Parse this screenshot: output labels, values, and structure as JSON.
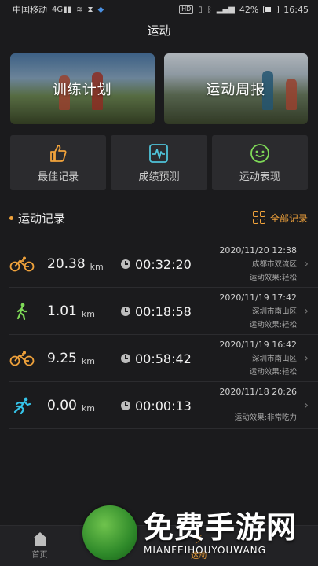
{
  "statusbar": {
    "carrier": "中国移动",
    "battery": "42%",
    "time": "16:45"
  },
  "header": {
    "title": "运动"
  },
  "banners": [
    {
      "label": "训练计划"
    },
    {
      "label": "运动周报"
    }
  ],
  "features": [
    {
      "label": "最佳记录",
      "icon": "thumbs-up-icon"
    },
    {
      "label": "成绩预测",
      "icon": "waveform-icon"
    },
    {
      "label": "运动表现",
      "icon": "smiley-icon"
    }
  ],
  "records_section": {
    "title": "运动记录",
    "all_link": "全部记录",
    "accent": "#f0a23b"
  },
  "records": [
    {
      "type": "cycling",
      "icon": "bicycle-icon",
      "distance": "20.38",
      "unit": "km",
      "duration": "00:32:20",
      "date": "2020/11/20 12:38",
      "location": "成都市双流区",
      "effect": "运动效果:轻松"
    },
    {
      "type": "walking",
      "icon": "walking-icon",
      "distance": "1.01",
      "unit": "km",
      "duration": "00:18:58",
      "date": "2020/11/19 17:42",
      "location": "深圳市南山区",
      "effect": "运动效果:轻松"
    },
    {
      "type": "cycling",
      "icon": "bicycle-icon",
      "distance": "9.25",
      "unit": "km",
      "duration": "00:58:42",
      "date": "2020/11/19 16:42",
      "location": "深圳市南山区",
      "effect": "运动效果:轻松"
    },
    {
      "type": "running",
      "icon": "running-icon",
      "distance": "0.00",
      "unit": "km",
      "duration": "00:00:13",
      "date": "2020/11/18 20:26",
      "location": "",
      "effect": "运动效果:非常吃力"
    }
  ],
  "bottomnav": {
    "tabs": [
      {
        "label": "首页",
        "icon": "home-icon"
      },
      {
        "label": "",
        "icon": ""
      },
      {
        "label": "运动",
        "icon": "sport-icon"
      },
      {
        "label": "",
        "icon": ""
      }
    ]
  },
  "watermark": {
    "cn": "免费手游网",
    "en": "MIANFEIHOUYOUWANG"
  }
}
